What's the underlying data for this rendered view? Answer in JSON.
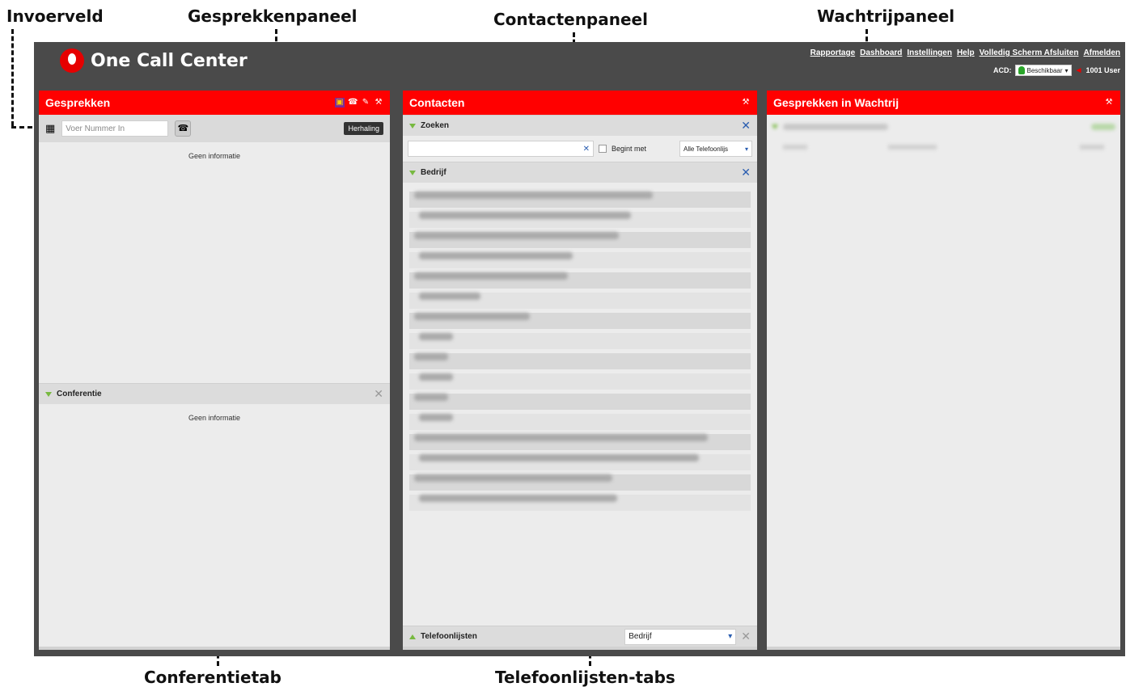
{
  "callouts": {
    "invoerveld": "Invoerveld",
    "gesprekkenpaneel": "Gesprekkenpaneel",
    "contactenpaneel": "Contactenpaneel",
    "wachtrijpaneel": "Wachtrijpaneel",
    "conferentietab": "Conferentietab",
    "telefoonlijsten_tabs": "Telefoonlijsten-tabs"
  },
  "brand": {
    "name": "One Call Center",
    "accent": "#e60000"
  },
  "topnav": {
    "items": [
      "Rapportage",
      "Dashboard",
      "Instellingen",
      "Help",
      "Volledig Scherm Afsluiten",
      "Afmelden"
    ],
    "acd_label": "ACD:",
    "acd_status": "Beschikbaar",
    "user": "1001 User"
  },
  "panels": {
    "calls": {
      "title": "Gesprekken",
      "input_placeholder": "Voer Nummer In",
      "redial": "Herhaling",
      "empty": "Geen informatie",
      "conference": {
        "title": "Conferentie",
        "empty": "Geen informatie"
      }
    },
    "contacts": {
      "title": "Contacten",
      "search": {
        "title": "Zoeken",
        "begins_with": "Begint met",
        "phonebook_select": "Alle Telefoonlijs"
      },
      "company": {
        "title": "Bedrijf"
      },
      "phonebooks": {
        "title": "Telefoonlijsten",
        "selected": "Bedrijf"
      }
    },
    "queue": {
      "title": "Gesprekken in Wachtrij"
    }
  }
}
